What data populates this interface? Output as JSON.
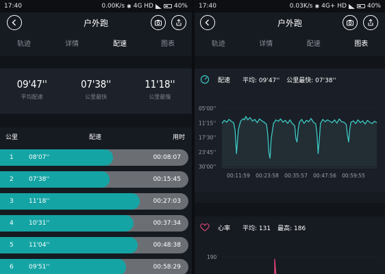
{
  "left": {
    "status": {
      "time": "17:40",
      "speed": "0.00K/s",
      "network": "4G HD",
      "battery": "40%"
    },
    "title": "户外跑",
    "tabs": [
      "轨迹",
      "详情",
      "配速",
      "图表"
    ],
    "active_tab": 2,
    "summary": [
      {
        "value": "09'47''",
        "label": "平均配速"
      },
      {
        "value": "07'38''",
        "label": "公里最快"
      },
      {
        "value": "11'18''",
        "label": "公里最慢"
      }
    ],
    "list_headers": {
      "km": "公里",
      "pace": "配速",
      "time": "用时"
    },
    "rows": [
      {
        "km": "1",
        "pace": "08'07''",
        "time": "00:08:07",
        "fill": 0.6
      },
      {
        "km": "2",
        "pace": "07'38''",
        "time": "00:15:45",
        "fill": 0.58
      },
      {
        "km": "3",
        "pace": "11'18''",
        "time": "00:27:03",
        "fill": 0.74
      },
      {
        "km": "4",
        "pace": "10'31''",
        "time": "00:37:34",
        "fill": 0.71
      },
      {
        "km": "5",
        "pace": "11'04''",
        "time": "00:48:38",
        "fill": 0.73
      },
      {
        "km": "6",
        "pace": "09'51''",
        "time": "00:58:29",
        "fill": 0.67
      }
    ]
  },
  "right": {
    "status": {
      "time": "17:40",
      "speed": "0.03K/s",
      "network": "4G+ HD",
      "battery": "40%"
    },
    "title": "户外跑",
    "tabs": [
      "轨迹",
      "详情",
      "配速",
      "图表"
    ],
    "active_tab": 3,
    "pace_chart": {
      "label": "配速",
      "avg": "平均: 09'47''",
      "fastest": "公里最快: 07'38''",
      "accent": "#3ec9c4"
    },
    "hr_chart": {
      "label": "心率",
      "avg": "平均: 131",
      "max": "最高: 186",
      "accent": "#e0457a"
    }
  },
  "chart_data": [
    {
      "type": "area",
      "title": "配速",
      "y_tick_labels": [
        "05'00''",
        "11'15''",
        "17'30''",
        "23'45''",
        "30'00''"
      ],
      "x_tick_labels": [
        "00:11:59",
        "00:23:58",
        "00:35:57",
        "00:47:56",
        "00:59:55"
      ],
      "ylim_minutes": [
        5,
        30
      ],
      "y_inverted": true,
      "x_range_minutes": [
        0,
        66
      ],
      "series": [
        {
          "x": [
            0,
            1,
            2,
            3,
            4,
            5,
            5.6,
            6.2,
            7,
            8,
            9,
            9.6,
            10.2,
            11,
            12,
            13,
            14,
            15,
            16,
            17,
            18,
            19,
            19.5,
            20,
            20.5,
            21,
            22,
            23,
            24,
            25,
            26,
            27,
            28,
            29,
            30,
            31,
            31.5,
            32,
            32.5,
            33,
            34,
            35,
            36,
            37,
            38,
            39,
            40,
            40.5,
            41,
            41.5,
            42,
            43,
            44,
            45,
            46,
            47,
            48,
            49,
            50,
            51,
            52,
            53,
            53.5,
            54,
            54.5,
            55,
            56,
            57,
            58,
            59,
            60,
            61,
            62,
            63,
            64,
            65,
            66
          ],
          "y": [
            11.5,
            10.2,
            11.0,
            9.8,
            10.6,
            11.3,
            14.5,
            24.5,
            14.0,
            10.5,
            9.5,
            10.0,
            8.5,
            10.0,
            9.0,
            10.5,
            9.8,
            11.2,
            9.6,
            10.4,
            11.0,
            12.0,
            16.0,
            24.0,
            26.5,
            18.0,
            11.5,
            10.0,
            10.6,
            9.6,
            11.0,
            10.2,
            11.5,
            10.0,
            11.6,
            12.5,
            18.0,
            19.5,
            14.0,
            11.0,
            9.8,
            11.5,
            10.2,
            10.8,
            9.4,
            11.0,
            11.8,
            16.0,
            24.5,
            18.5,
            11.5,
            9.8,
            10.8,
            10.0,
            10.6,
            11.2,
            10.0,
            11.4,
            9.6,
            10.8,
            11.0,
            12.0,
            16.5,
            19.5,
            14.0,
            11.0,
            10.4,
            11.6,
            10.0,
            11.2,
            10.4,
            11.8,
            10.2,
            11.0,
            11.6,
            10.6,
            11.2
          ]
        }
      ]
    },
    {
      "type": "line",
      "title": "心率",
      "y_tick_labels": [
        "190"
      ]
    }
  ]
}
